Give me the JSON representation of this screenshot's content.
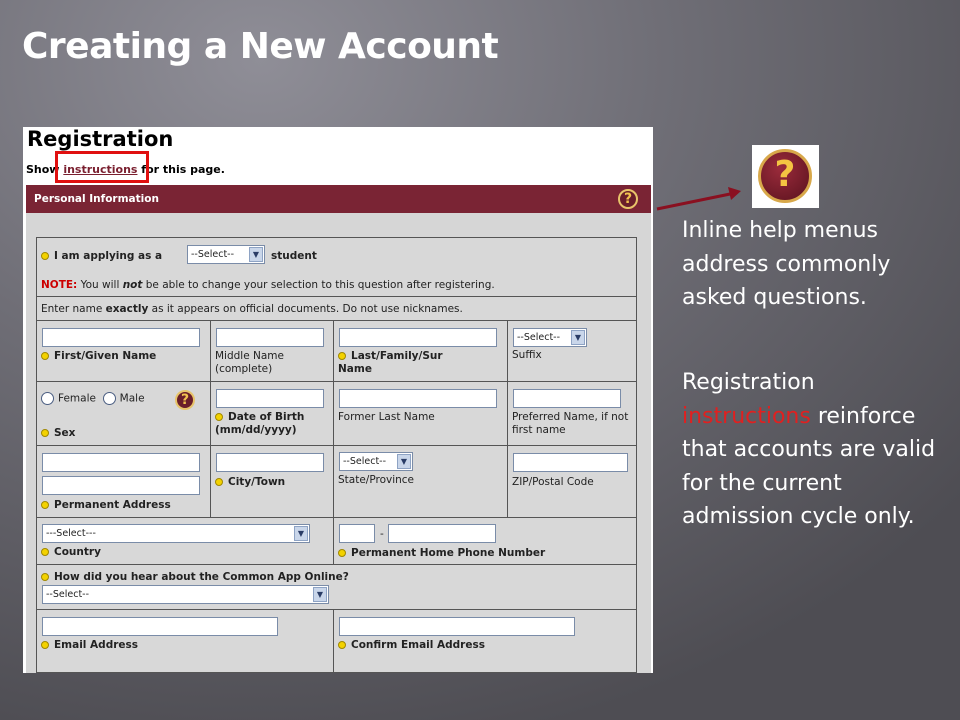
{
  "slide": {
    "title": "Creating a New Account"
  },
  "form": {
    "heading": "Registration",
    "show_prefix": "Show ",
    "instructions_link": "instructions",
    "show_suffix": " for this page.",
    "section": "Personal Information",
    "applying_label": "I am applying as a",
    "applying_select": "--Select--",
    "applying_suffix": "student",
    "note_label": "NOTE:",
    "note_text_1": " You will ",
    "note_not": "not",
    "note_text_2": " be able to change your selection to this question after registering.",
    "name_hint_1": "Enter name ",
    "name_hint_exactly": "exactly",
    "name_hint_2": " as it appears on official documents. Do not use nicknames.",
    "first_name": "First/Given Name",
    "middle_name": "Middle Name (complete)",
    "last_name": "Last/Family/Sur Name",
    "suffix_select": "--Select--",
    "suffix": "Suffix",
    "female": "Female",
    "male": "Male",
    "sex": "Sex",
    "dob": "Date of Birth (mm/dd/yyyy)",
    "former_last": "Former Last Name",
    "preferred_name": "Preferred Name, if not first name",
    "perm_address": "Permanent Address",
    "city": "City/Town",
    "state_select": "--Select--",
    "state": "State/Province",
    "zip": "ZIP/Postal Code",
    "country_select": "---Select---",
    "country": "Country",
    "phone_dash": "-",
    "phone": "Permanent Home Phone Number",
    "hear_about": "How did you hear about the Common App Online?",
    "hear_select": "--Select--",
    "email": "Email Address",
    "confirm_email": "Confirm Email Address",
    "help_glyph": "?"
  },
  "side": {
    "help_glyph": "?",
    "para1": "Inline help menus address commonly asked questions.",
    "para2_a": "Registration ",
    "para2_red": "instructions",
    "para2_b": " reinforce that accounts are valid for the current admission cycle only."
  }
}
